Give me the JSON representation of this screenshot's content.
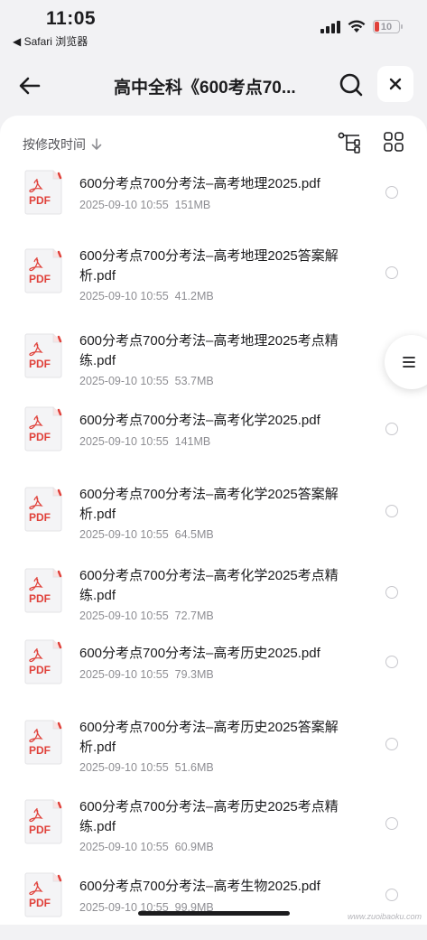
{
  "status_bar": {
    "time": "11:05",
    "back_to_app": "◀ Safari 浏览器",
    "battery_percent": "10",
    "battery_color": "#e0413a"
  },
  "nav": {
    "title": "高中全科《600考点70..."
  },
  "sort": {
    "label": "按修改时间"
  },
  "files": [
    {
      "name": "600分考点700分考法–高考地理2025.pdf",
      "date": "2025-09-10 10:55",
      "size": "151MB"
    },
    {
      "name": "600分考点700分考法–高考地理2025答案解析.pdf",
      "date": "2025-09-10 10:55",
      "size": "41.2MB"
    },
    {
      "name": "600分考点700分考法–高考地理2025考点精练.pdf",
      "date": "2025-09-10 10:55",
      "size": "53.7MB"
    },
    {
      "name": "600分考点700分考法–高考化学2025.pdf",
      "date": "2025-09-10 10:55",
      "size": "141MB"
    },
    {
      "name": "600分考点700分考法–高考化学2025答案解析.pdf",
      "date": "2025-09-10 10:55",
      "size": "64.5MB"
    },
    {
      "name": "600分考点700分考法–高考化学2025考点精练.pdf",
      "date": "2025-09-10 10:55",
      "size": "72.7MB"
    },
    {
      "name": "600分考点700分考法–高考历史2025.pdf",
      "date": "2025-09-10 10:55",
      "size": "79.3MB"
    },
    {
      "name": "600分考点700分考法–高考历史2025答案解析.pdf",
      "date": "2025-09-10 10:55",
      "size": "51.6MB"
    },
    {
      "name": "600分考点700分考法–高考历史2025考点精练.pdf",
      "date": "2025-09-10 10:55",
      "size": "60.9MB"
    },
    {
      "name": "600分考点700分考法–高考生物2025.pdf",
      "date": "2025-09-10 10:55",
      "size": "99.9MB"
    }
  ],
  "pdf_badge": "PDF",
  "watermark": "www.zuoibaoku.com",
  "icons": {
    "back": "arrow-left-icon",
    "search": "search-icon",
    "close": "close-icon",
    "sort": "arrow-down-icon",
    "tree": "tree-view-icon",
    "grid": "grid-view-icon",
    "menu": "menu-icon"
  }
}
